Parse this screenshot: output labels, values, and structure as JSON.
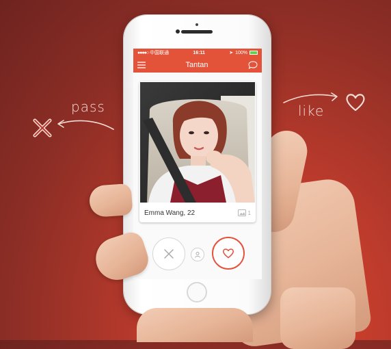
{
  "annotations": {
    "pass_label": "pass",
    "like_label": "like"
  },
  "status_bar": {
    "carrier": "中国联通",
    "time": "16:11",
    "battery": "100%"
  },
  "nav": {
    "title": "Tantan",
    "menu_icon": "menu-icon",
    "chat_icon": "chat-bubble-icon"
  },
  "card": {
    "name_age": "Emma Wang, 22",
    "photo_count": "1"
  },
  "actions": {
    "pass_icon": "close-icon",
    "profile_icon": "profile-icon",
    "like_icon": "heart-icon"
  },
  "colors": {
    "brand": "#e2533a",
    "background": "#a8352a"
  }
}
